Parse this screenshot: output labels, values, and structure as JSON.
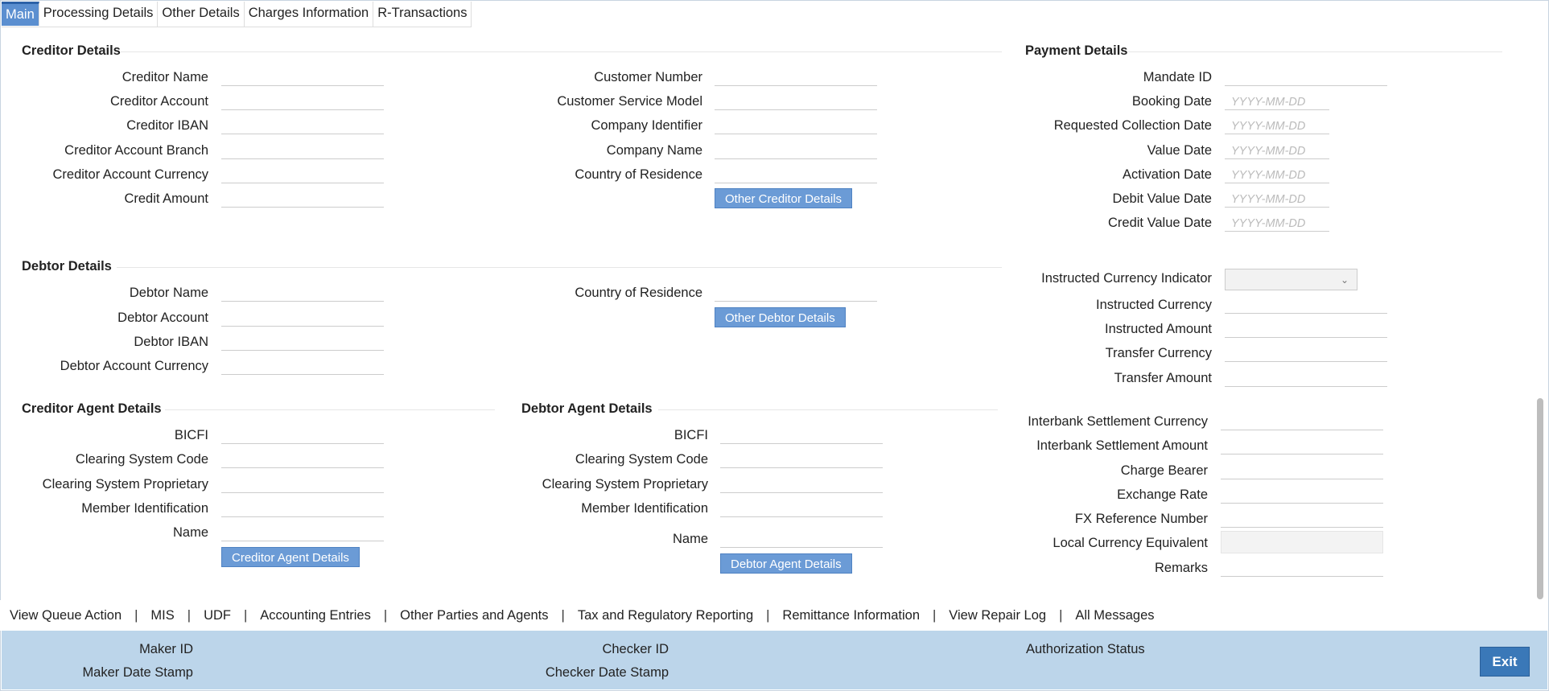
{
  "tabs": [
    "Main",
    "Processing Details",
    "Other Details",
    "Charges Information",
    "R-Transactions"
  ],
  "creditor": {
    "title": "Creditor Details",
    "labels": [
      "Creditor Name",
      "Creditor Account",
      "Creditor IBAN",
      "Creditor Account Branch",
      "Creditor Account Currency",
      "Credit Amount"
    ],
    "right_labels": [
      "Customer Number",
      "Customer Service Model",
      "Company Identifier",
      "Company Name",
      "Country of Residence"
    ],
    "other_button": "Other Creditor Details"
  },
  "debtor": {
    "title": "Debtor Details",
    "labels": [
      "Debtor Name",
      "Debtor Account",
      "Debtor IBAN",
      "Debtor Account Currency"
    ],
    "right_labels": [
      "Country of Residence"
    ],
    "other_button": "Other Debtor Details"
  },
  "creditor_agent": {
    "title": "Creditor Agent Details",
    "labels": [
      "BICFI",
      "Clearing System Code",
      "Clearing System Proprietary",
      "Member Identification",
      "Name"
    ],
    "button": "Creditor Agent Details"
  },
  "debtor_agent": {
    "title": "Debtor Agent Details",
    "labels": [
      "BICFI",
      "Clearing System Code",
      "Clearing System Proprietary",
      "Member Identification",
      "Name"
    ],
    "button": "Debtor Agent Details"
  },
  "payment": {
    "title": "Payment Details",
    "labels": [
      "Mandate ID",
      "Booking Date",
      "Requested Collection Date",
      "Value Date",
      "Activation Date",
      "Debit Value Date",
      "Credit Value Date"
    ],
    "date_placeholder": "YYYY-MM-DD",
    "instructed_labels": [
      "Instructed Currency Indicator",
      "Instructed Currency",
      "Instructed Amount",
      "Transfer Currency",
      "Transfer Amount"
    ],
    "settlement_labels": [
      "Interbank Settlement Currency",
      "Interbank Settlement Amount",
      "Charge Bearer",
      "Exchange Rate",
      "FX Reference Number",
      "Local Currency Equivalent",
      "Remarks"
    ]
  },
  "bottom_links": [
    "View Queue Action",
    "MIS",
    "UDF",
    "Accounting Entries",
    "Other Parties and Agents",
    "Tax and Regulatory Reporting",
    "Remittance Information",
    "View Repair Log",
    "All Messages"
  ],
  "footer": {
    "maker_id": "Maker ID",
    "maker_date": "Maker Date Stamp",
    "checker_id": "Checker ID",
    "checker_date": "Checker Date Stamp",
    "auth_status": "Authorization Status",
    "exit": "Exit"
  },
  "colors": {
    "accent": "#5b8fd0",
    "footer_bg": "#bcd5ea",
    "exit_bg": "#3a78b8"
  }
}
